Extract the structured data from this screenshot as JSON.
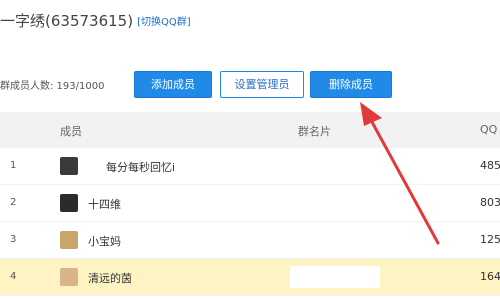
{
  "header": {
    "group_name": "一字绣(63573615)",
    "switch_link": "[切换QQ群]"
  },
  "toolbar": {
    "member_count": "群成员人数: 193/1000",
    "add_label": "添加成员",
    "admin_label": "设置管理员",
    "delete_label": "删除成员"
  },
  "table": {
    "headers": {
      "member": "成员",
      "card": "群名片",
      "qq": "QQ"
    },
    "rows": [
      {
        "num": "1",
        "nick": "每分每秒回忆i",
        "qq": "485"
      },
      {
        "num": "2",
        "nick": "十四维",
        "qq": "803"
      },
      {
        "num": "3",
        "nick": "小宝妈",
        "qq": "125"
      },
      {
        "num": "4",
        "nick": "清远的茵",
        "qq": "164"
      }
    ]
  },
  "colors": {
    "primary_button": "#1f8ae8",
    "selected_row": "#fdf3c3",
    "annotation_arrow": "#e03a3a"
  }
}
